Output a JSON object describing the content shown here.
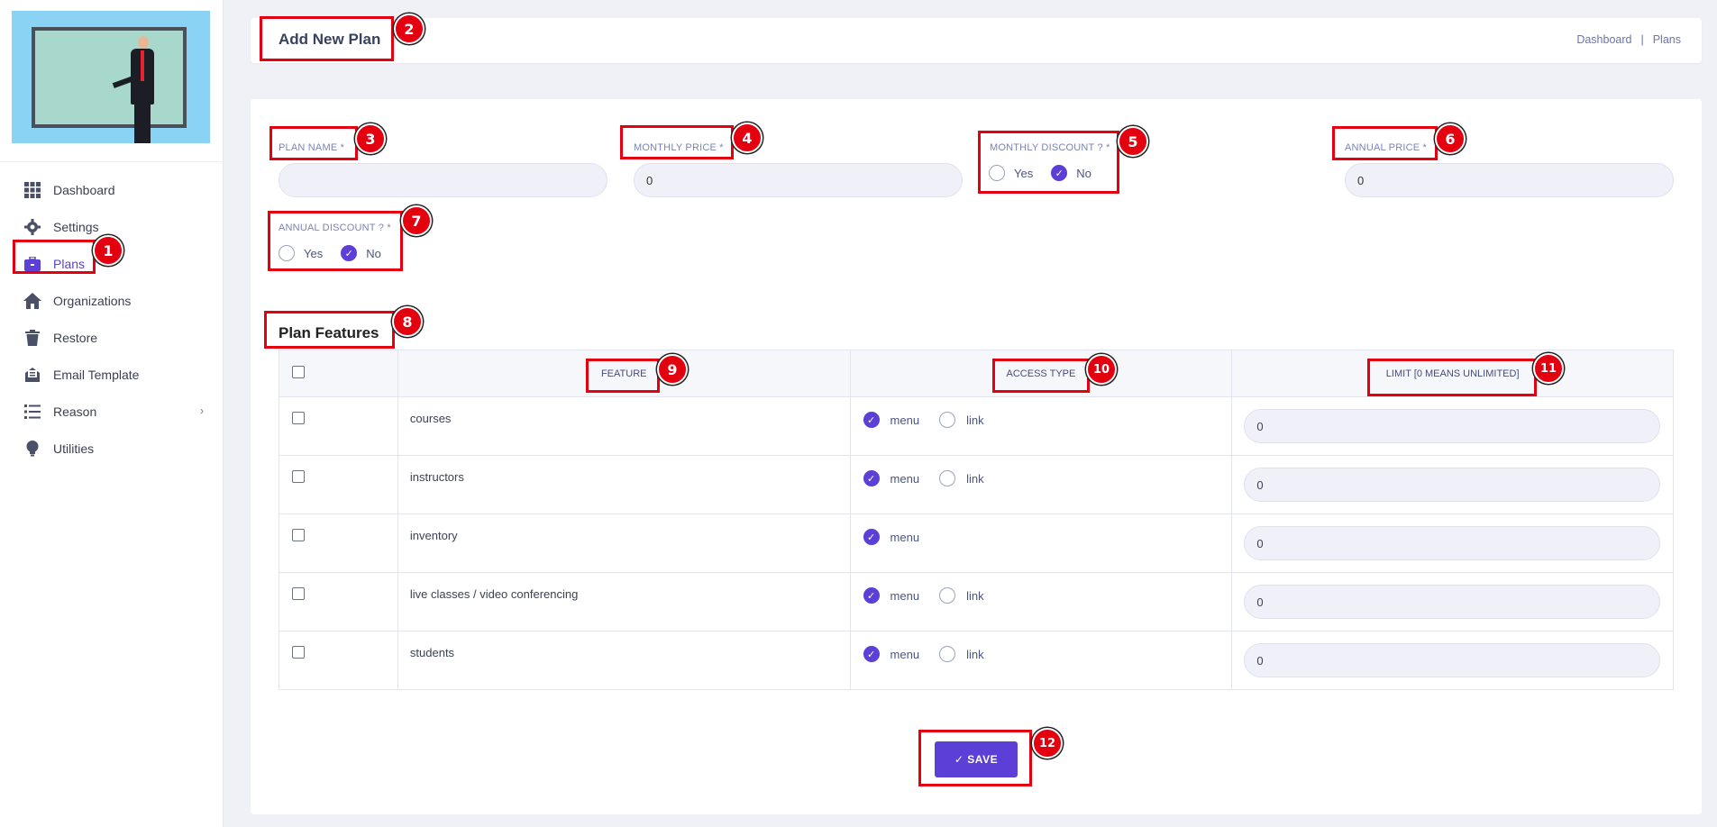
{
  "sidebar": {
    "items": [
      {
        "label": "Dashboard",
        "icon": "grid-icon"
      },
      {
        "label": "Settings",
        "icon": "gear-icon"
      },
      {
        "label": "Plans",
        "icon": "briefcase-icon",
        "active": true
      },
      {
        "label": "Organizations",
        "icon": "home-icon"
      },
      {
        "label": "Restore",
        "icon": "trash-icon"
      },
      {
        "label": "Email Template",
        "icon": "mail-icon"
      },
      {
        "label": "Reason",
        "icon": "list-icon",
        "chevron": true
      },
      {
        "label": "Utilities",
        "icon": "bulb-icon"
      }
    ]
  },
  "header": {
    "title": "Add New Plan",
    "breadcrumb": [
      "Dashboard",
      "|",
      "Plans"
    ]
  },
  "form": {
    "plan_name": {
      "label": "PLAN NAME *",
      "value": ""
    },
    "monthly_price": {
      "label": "MONTHLY PRICE *",
      "value": "0"
    },
    "monthly_discount": {
      "label": "MONTHLY DISCOUNT ? *",
      "yes": "Yes",
      "no": "No",
      "selected": "No"
    },
    "annual_price": {
      "label": "ANNUAL PRICE *",
      "value": "0"
    },
    "annual_discount": {
      "label": "ANNUAL DISCOUNT ? *",
      "yes": "Yes",
      "no": "No",
      "selected": "No"
    }
  },
  "features": {
    "title": "Plan Features",
    "headers": {
      "feature": "FEATURE",
      "access": "ACCESS TYPE",
      "limit": "LIMIT [0 MEANS UNLIMITED]"
    },
    "access_labels": {
      "menu": "menu",
      "link": "link"
    },
    "rows": [
      {
        "name": "courses",
        "access": "menu",
        "has_link": true,
        "limit": "0"
      },
      {
        "name": "instructors",
        "access": "menu",
        "has_link": true,
        "limit": "0"
      },
      {
        "name": "inventory",
        "access": "menu",
        "has_link": false,
        "limit": "0"
      },
      {
        "name": "live classes / video conferencing",
        "access": "menu",
        "has_link": true,
        "limit": "0"
      },
      {
        "name": "students",
        "access": "menu",
        "has_link": true,
        "limit": "0"
      }
    ]
  },
  "actions": {
    "save_label": "✓ SAVE"
  },
  "annotations": [
    "1",
    "2",
    "3",
    "4",
    "5",
    "6",
    "7",
    "8",
    "9",
    "10",
    "11",
    "12"
  ],
  "colors": {
    "accent": "#5b3fd6",
    "annotation": "#e3000f"
  }
}
